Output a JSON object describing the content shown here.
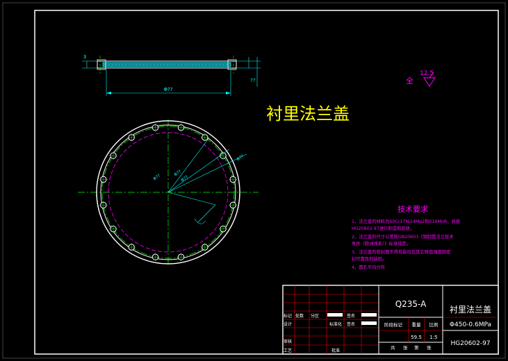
{
  "drawing": {
    "title": "衬里法兰盖",
    "surface_finish": {
      "prefix": "全",
      "value": "12.5"
    },
    "dims": {
      "top_width": "Φ??",
      "side_top": "3",
      "side_right": "??"
    },
    "circle_dims": [
      "Φ??",
      "Φ??",
      "Φ??",
      "Φ??"
    ],
    "bolt_holes": 16
  },
  "tech": {
    "heading": "技术要求",
    "lines": [
      "1、法兰盖的材料为00Cr17Ni14Mo2和016MnR，并按",
      "   HG20602-97进行制造和验收。",
      "2、法兰盖的尺寸公差按GB20603《钢制管法兰技术",
      "   条件（欧洲体系）》标准规定。",
      "3、法兰盖的密封面不得有裂纹及其它降低强度和密",
      "   封可靠性的缺陷。",
      "4、圆孔平均分布"
    ]
  },
  "titleblock": {
    "material": "Q235-A",
    "part_name": "衬里法兰盖",
    "spec": "Φ450-0.6MPa",
    "std_no": "HG20602-97",
    "weight": "59.5",
    "scale": "1:5",
    "stage_label": "阶段标记",
    "weight_label": "重量",
    "scale_label": "比例",
    "sheet_total": "共",
    "sheet_label": "张",
    "sheet_no": "第",
    "sheet_label2": "张",
    "rev_label": "标记",
    "count_label": "处数",
    "zone_label": "分区",
    "sign_label": "签名",
    "design_label": "设计",
    "std_label": "标准化",
    "sign_label2": "签名",
    "check_label": "审核",
    "craft_label": "工艺",
    "approve_label": "批准"
  },
  "colors": {
    "background": "#000000",
    "border": "#ffffff",
    "title": "#ffff00",
    "outline": "#ffffff",
    "dim": "#00ffff",
    "center": "#00ff00",
    "magenta": "#ff00ff",
    "grid": "#ff0000"
  }
}
